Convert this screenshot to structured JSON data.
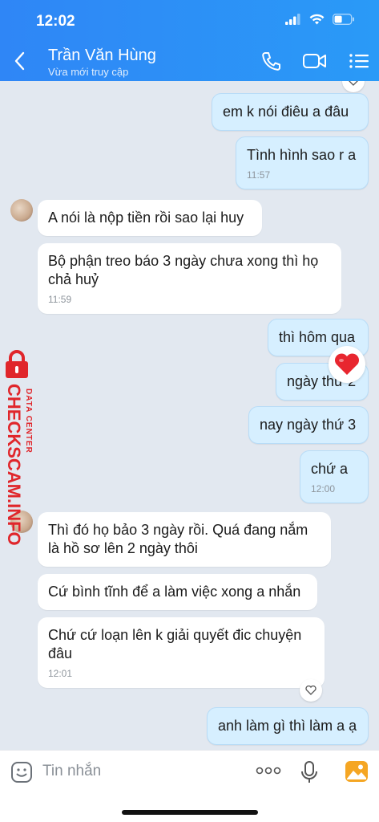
{
  "status_bar": {
    "time": "12:02"
  },
  "header": {
    "contact_name": "Trần Văn Hùng",
    "contact_status": "Vừa mới truy cập",
    "icons": [
      "back-arrow-icon",
      "phone-icon",
      "video-call-icon",
      "menu-list-icon"
    ]
  },
  "messages": [
    {
      "side": "me",
      "text": "em k nói  điêu a đâu"
    },
    {
      "side": "me",
      "text": "Tình hình sao r a",
      "time": "11:57"
    },
    {
      "side": "them",
      "text": "A nói là nộp tiền rồi sao lại huy"
    },
    {
      "side": "them",
      "text": "Bộ phận treo báo 3 ngày chưa xong thì họ chả huỷ",
      "time": "11:59"
    },
    {
      "side": "me",
      "text": "thì hôm qua"
    },
    {
      "side": "me",
      "text": "ngày thứ 2"
    },
    {
      "side": "me",
      "text": "nay ngày thứ 3"
    },
    {
      "side": "me",
      "text": "chứ  a",
      "time": "12:00"
    },
    {
      "side": "them",
      "text": "Thì đó họ bảo 3 ngày rồi. Quá đang nắm là hồ sơ lên 2 ngày thôi"
    },
    {
      "side": "them",
      "text": "Cứ bình tĩnh để a làm việc xong a nhắn"
    },
    {
      "side": "them",
      "text": "Chứ cứ loạn lên k giải quyết đic chuyện đâu",
      "time": "12:01"
    },
    {
      "side": "me",
      "text": "anh làm gì thì làm a ạ"
    }
  ],
  "watermark": {
    "main": "CHECKSCAM.INFO",
    "sub": "DATA CENTER"
  },
  "input_bar": {
    "placeholder": "Tin nhắn"
  },
  "colors": {
    "header": "#2f86f6",
    "my_bubble": "#d6efff",
    "their_bubble": "#ffffff",
    "background": "#e2e8f0",
    "watermark": "#e0262b"
  }
}
